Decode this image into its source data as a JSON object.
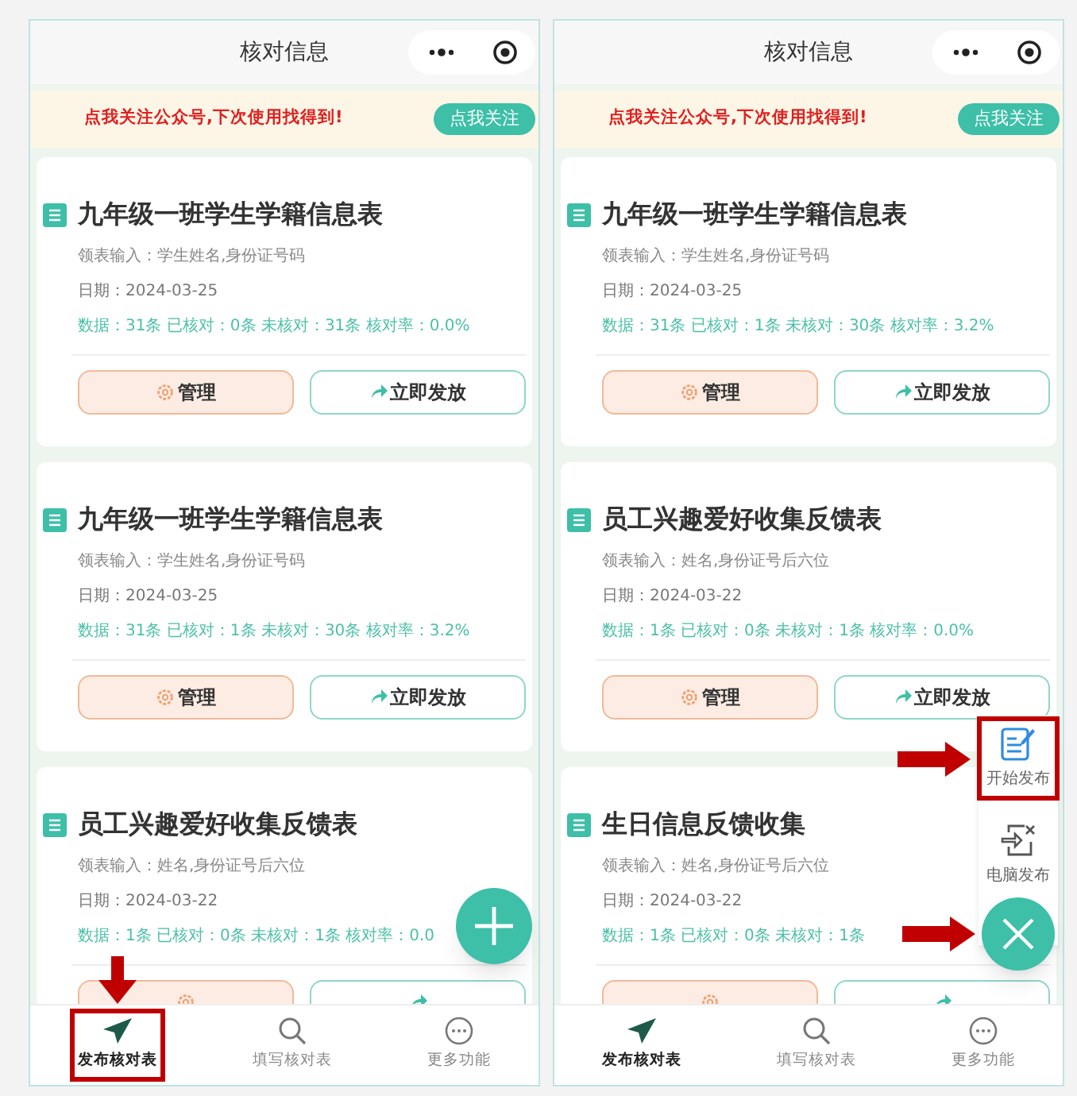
{
  "screens": [
    {
      "header": {
        "title": "核对信息"
      },
      "banner": {
        "text": "点我关注公众号,下次使用找得到!",
        "button": "点我关注"
      },
      "cards": [
        {
          "title": "九年级一班学生学籍信息表",
          "fields": "领表输入：学生姓名,身份证号码",
          "date": "日期：2024-03-25",
          "stats": "数据：31条 已核对：0条 未核对：31条 核对率：0.0%",
          "manage": "管理",
          "publish": "立即发放"
        },
        {
          "title": "九年级一班学生学籍信息表",
          "fields": "领表输入：学生姓名,身份证号码",
          "date": "日期：2024-03-25",
          "stats": "数据：31条 已核对：1条 未核对：30条 核对率：3.2%",
          "manage": "管理",
          "publish": "立即发放"
        },
        {
          "title": "员工兴趣爱好收集反馈表",
          "fields": "领表输入：姓名,身份证号后六位",
          "date": "日期：2024-03-22",
          "stats": "数据：1条 已核对：0条 未核对：1条 核对率：0.0"
        }
      ],
      "fab": {
        "kind": "add"
      },
      "tabs": [
        {
          "label": "发布核对表",
          "selected": true,
          "highlighted": true
        },
        {
          "label": "填写核对表",
          "selected": false,
          "highlighted": false
        },
        {
          "label": "更多功能",
          "selected": false,
          "highlighted": false
        }
      ]
    },
    {
      "header": {
        "title": "核对信息"
      },
      "banner": {
        "text": "点我关注公众号,下次使用找得到!",
        "button": "点我关注"
      },
      "cards": [
        {
          "title": "九年级一班学生学籍信息表",
          "fields": "领表输入：学生姓名,身份证号码",
          "date": "日期：2024-03-25",
          "stats": "数据：31条 已核对：1条 未核对：30条 核对率：3.2%",
          "manage": "管理",
          "publish": "立即发放"
        },
        {
          "title": "员工兴趣爱好收集反馈表",
          "fields": "领表输入：姓名,身份证号后六位",
          "date": "日期：2024-03-22",
          "stats": "数据：1条 已核对：0条 未核对：1条 核对率：0.0%",
          "manage": "管理",
          "publish": "立即发放"
        },
        {
          "title": "生日信息反馈收集",
          "fields": "领表输入：姓名,身份证号后六位",
          "date": "日期：2024-03-22",
          "stats": "数据：1条 已核对：0条 未核对：1条"
        }
      ],
      "fab": {
        "kind": "close",
        "highlighted": true,
        "menu": [
          {
            "kind": "edit",
            "label": "开始发布",
            "highlighted": true
          },
          {
            "kind": "computer",
            "label": "电脑发布",
            "highlighted": false
          }
        ]
      },
      "tabs": [
        {
          "label": "发布核对表",
          "selected": true,
          "highlighted": false
        },
        {
          "label": "填写核对表",
          "selected": false,
          "highlighted": false
        },
        {
          "label": "更多功能",
          "selected": false,
          "highlighted": false
        }
      ]
    }
  ]
}
